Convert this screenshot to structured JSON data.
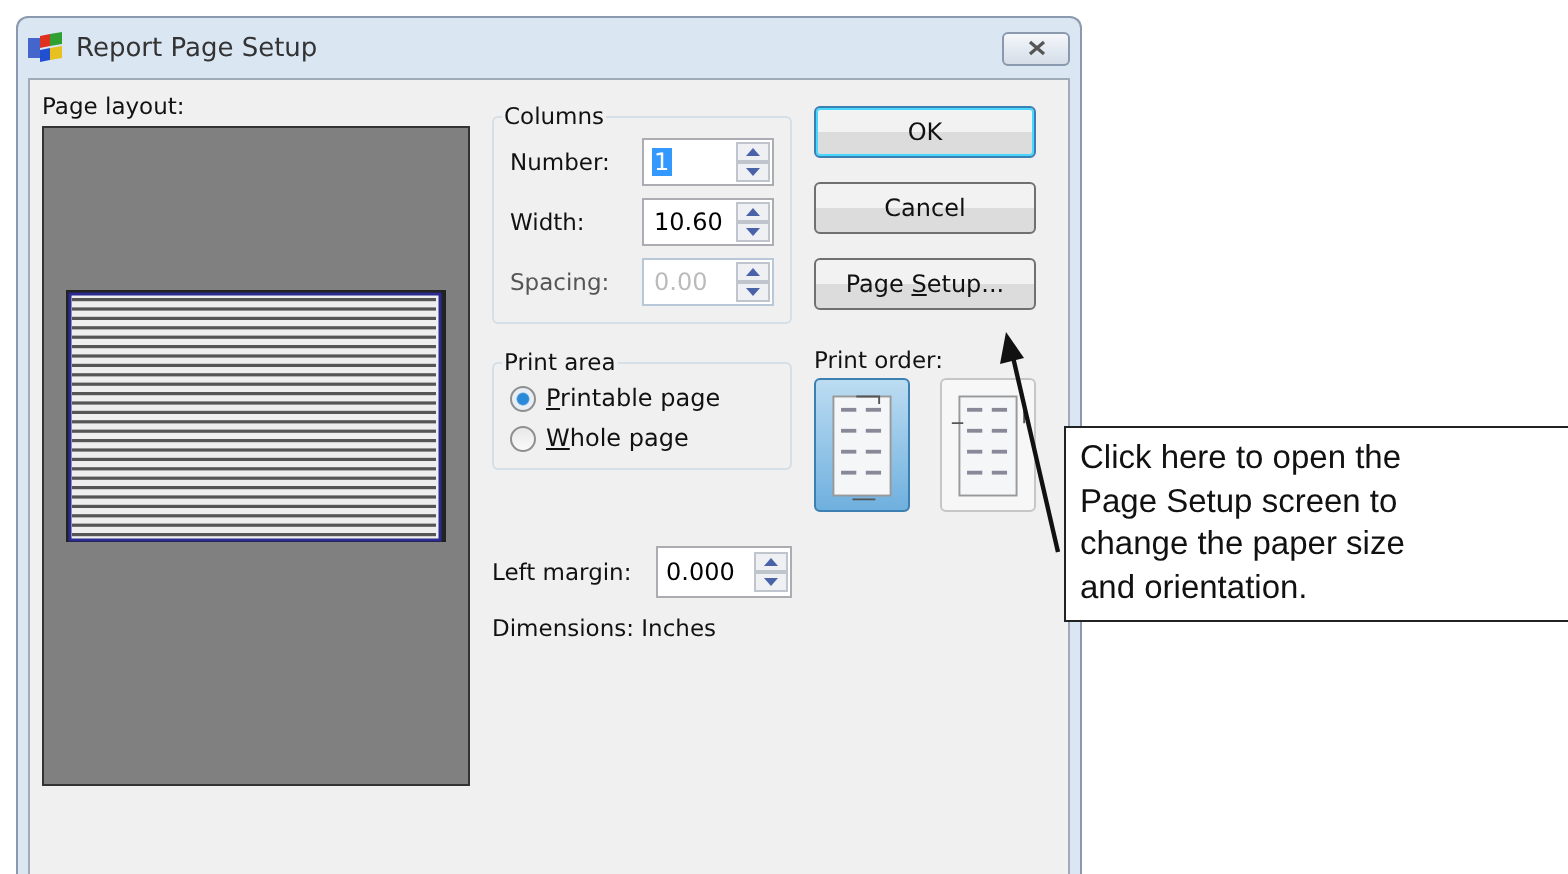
{
  "window": {
    "title": "Report Page Setup"
  },
  "page_layout": {
    "label": "Page layout:"
  },
  "columns": {
    "title": "Columns",
    "fields": [
      {
        "label": "Number:",
        "value": "1",
        "selected": true,
        "disabled": false
      },
      {
        "label": "Width:",
        "value": "10.60",
        "selected": false,
        "disabled": false
      },
      {
        "label": "Spacing:",
        "value": "0.00",
        "selected": false,
        "disabled": true
      }
    ]
  },
  "print_area": {
    "title": "Print area",
    "options": [
      {
        "key": "P",
        "rest": "rintable page",
        "selected": true
      },
      {
        "key": "W",
        "rest": "hole page",
        "selected": false
      }
    ]
  },
  "buttons": [
    {
      "before": "OK",
      "default": true
    },
    {
      "before": "Cancel",
      "default": false
    },
    {
      "before": "Page ",
      "key": "S",
      "after": "etup...",
      "default": false
    }
  ],
  "print_order": {
    "label": "Print order:",
    "options": [
      {
        "kind": "down-then-over",
        "selected": true
      },
      {
        "kind": "over-then-down",
        "selected": false
      }
    ]
  },
  "left_margin": {
    "label": "Left margin:",
    "value": "0.000"
  },
  "dimensions": "Dimensions: Inches",
  "callout": [
    "Click here to open the",
    "Page Setup screen to",
    "change the paper size",
    "and orientation."
  ]
}
